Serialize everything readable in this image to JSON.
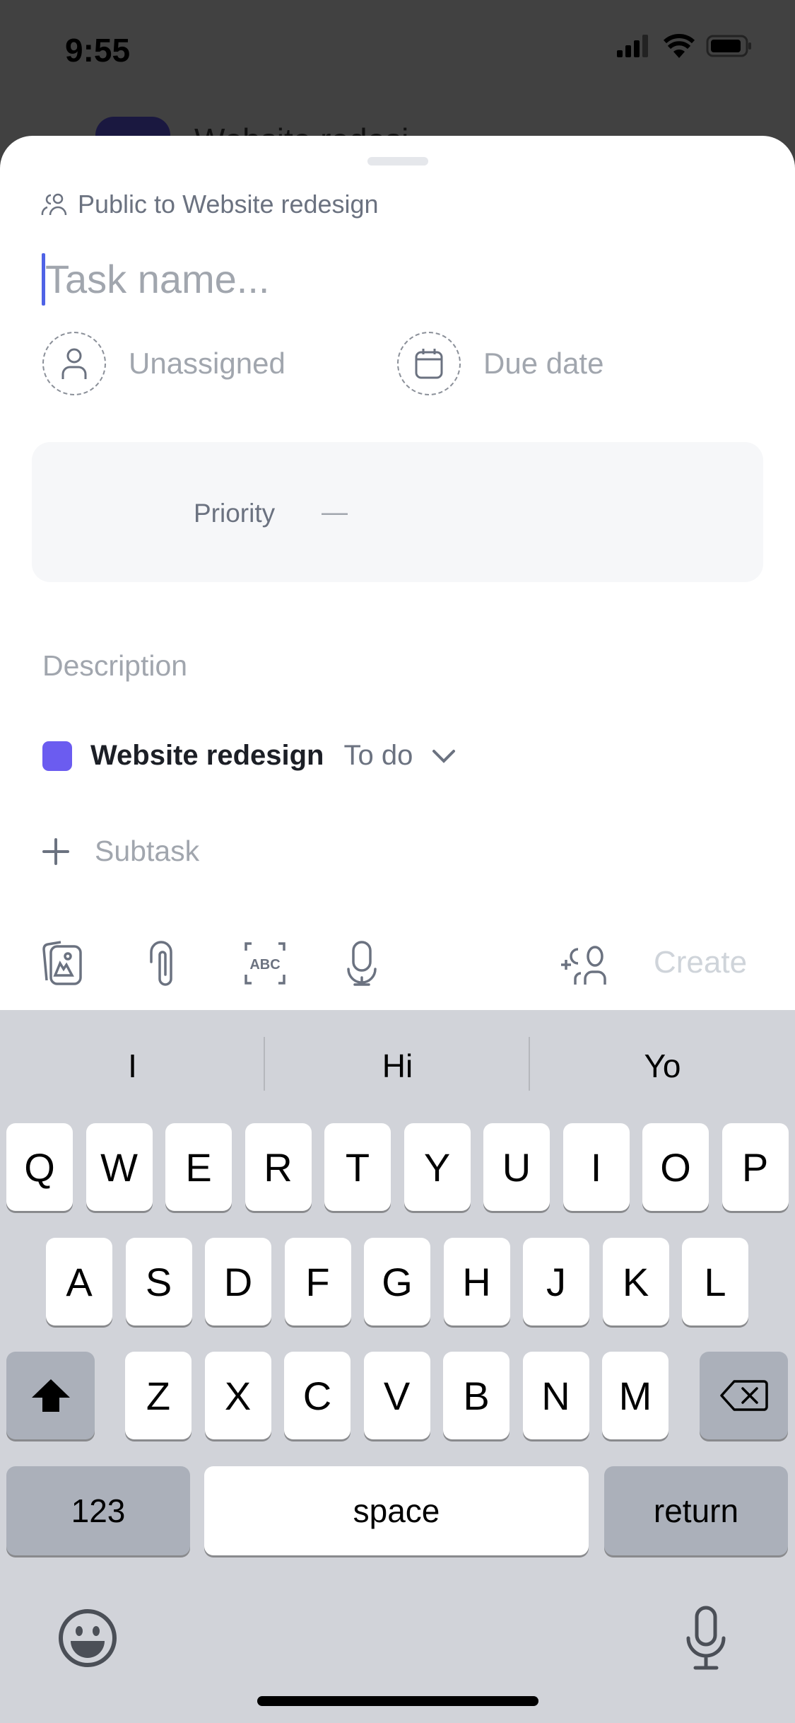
{
  "status_bar": {
    "time": "9:55"
  },
  "background": {
    "title": "Website redesi"
  },
  "sheet": {
    "visibility": "Public to Website redesign",
    "task_name_placeholder": "Task name...",
    "assignee": "Unassigned",
    "due_date": "Due date",
    "priority_label": "Priority",
    "priority_value": "—",
    "description_placeholder": "Description",
    "project": {
      "name": "Website redesign",
      "status": "To do",
      "color": "#6b5cf0"
    },
    "subtask_label": "Subtask",
    "toolbar": {
      "icons": [
        "photo-icon",
        "paperclip-icon",
        "scan-text-icon",
        "microphone-icon",
        "add-people-icon"
      ],
      "create_label": "Create"
    }
  },
  "keyboard": {
    "suggestions": [
      "I",
      "Hi",
      "Yo"
    ],
    "rows": [
      [
        "Q",
        "W",
        "E",
        "R",
        "T",
        "Y",
        "U",
        "I",
        "O",
        "P"
      ],
      [
        "A",
        "S",
        "D",
        "F",
        "G",
        "H",
        "J",
        "K",
        "L"
      ],
      [
        "Z",
        "X",
        "C",
        "V",
        "B",
        "N",
        "M"
      ]
    ],
    "numbers_label": "123",
    "space_label": "space",
    "return_label": "return"
  }
}
